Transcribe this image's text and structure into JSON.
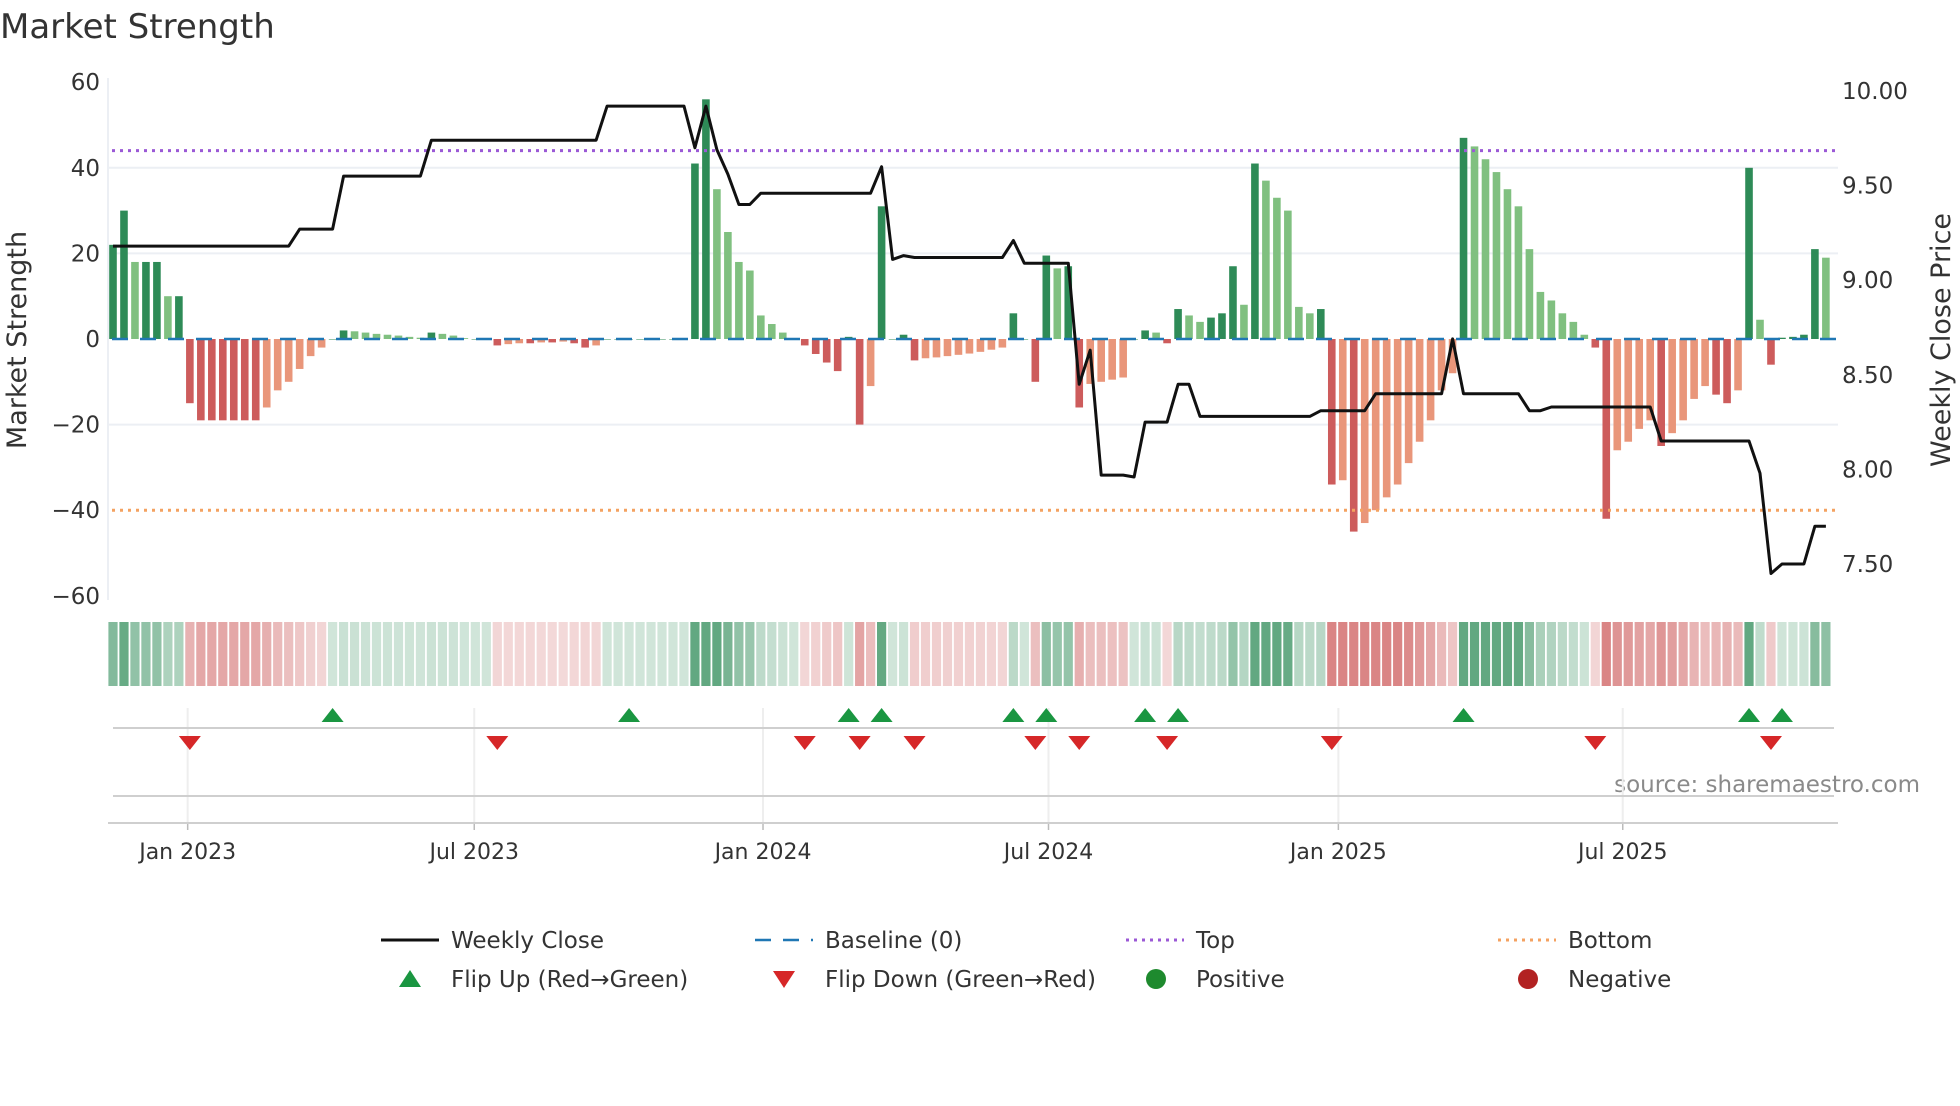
{
  "chart_data": {
    "type": "bar",
    "title": "Market Strength",
    "ylabel": "Market Strength",
    "y2label": "Weekly Close Price",
    "ylim": [
      -60,
      60
    ],
    "y2lim": [
      7.35,
      10.05
    ],
    "yticks": [
      "60",
      "40",
      "20",
      "0",
      "−20",
      "−40",
      "−60"
    ],
    "ytick_values": [
      60,
      40,
      20,
      0,
      -20,
      -40,
      -60
    ],
    "y2ticks": [
      "10.00",
      "9.50",
      "9.00",
      "8.50",
      "8.00",
      "7.50"
    ],
    "y2tick_values": [
      10,
      9.5,
      9,
      8.5,
      8,
      7.5
    ],
    "xticks": [
      {
        "label": "Jan 2023",
        "week": 6.8
      },
      {
        "label": "Jul 2023",
        "week": 32.9
      },
      {
        "label": "Jan 2024",
        "week": 59.2
      },
      {
        "label": "Jul 2024",
        "week": 85.2
      },
      {
        "label": "Jan 2025",
        "week": 111.6
      },
      {
        "label": "Jul 2025",
        "week": 137.5
      }
    ],
    "top_level": 44,
    "bottom_level": -40,
    "baseline": 0,
    "strength": [
      22,
      30,
      18,
      18,
      18,
      10,
      10,
      -15,
      -19,
      -19,
      -19,
      -19,
      -19,
      -19,
      -16,
      -12,
      -10,
      -7,
      -4,
      -2,
      0,
      2,
      1.8,
      1.5,
      1.2,
      1,
      0.8,
      0.5,
      0.3,
      1.5,
      1.2,
      0.8,
      0.2,
      0,
      0,
      -1.5,
      -1.2,
      -1,
      -1,
      -0.8,
      -0.8,
      -0.6,
      -1,
      -2,
      -1.5,
      0,
      0,
      0,
      0,
      0,
      0,
      0,
      0,
      41,
      56,
      35,
      25,
      18,
      16,
      5.5,
      3.5,
      1.5,
      0,
      -1.5,
      -3.5,
      -5.5,
      -7.5,
      0.5,
      -20,
      -11,
      31,
      0,
      1,
      -5,
      -4.5,
      -4.3,
      -4,
      -3.7,
      -3.4,
      -3,
      -2.5,
      -2,
      6,
      0,
      -10,
      19.5,
      16.5,
      17,
      -16,
      -10.5,
      -10,
      -9.5,
      -9,
      0,
      2,
      1.5,
      -1,
      7,
      5.5,
      4,
      5,
      6,
      17,
      8,
      41,
      37,
      33,
      30,
      7.5,
      6,
      7,
      -34,
      -33,
      -45,
      -43,
      -40,
      -37,
      -34,
      -29,
      -24,
      -19,
      -12,
      -8,
      47,
      45,
      42,
      39,
      35,
      31,
      21,
      11,
      9,
      6,
      4,
      1,
      -2,
      -42,
      -26,
      -24,
      -21,
      -19,
      -25,
      -22,
      -19,
      -14,
      -11,
      -13,
      -15,
      -12,
      40,
      4.5,
      -6,
      0.3,
      0.5,
      1,
      21,
      19
    ],
    "weekly_close": [
      9.18,
      9.18,
      9.18,
      9.18,
      9.18,
      9.18,
      9.18,
      9.18,
      9.18,
      9.18,
      9.18,
      9.18,
      9.18,
      9.18,
      9.18,
      9.18,
      9.18,
      9.27,
      9.27,
      9.27,
      9.27,
      9.55,
      9.55,
      9.55,
      9.55,
      9.55,
      9.55,
      9.55,
      9.55,
      9.74,
      9.74,
      9.74,
      9.74,
      9.74,
      9.74,
      9.74,
      9.74,
      9.74,
      9.74,
      9.74,
      9.74,
      9.74,
      9.74,
      9.74,
      9.74,
      9.92,
      9.92,
      9.92,
      9.92,
      9.92,
      9.92,
      9.92,
      9.92,
      9.7,
      9.92,
      9.69,
      9.56,
      9.4,
      9.4,
      9.46,
      9.46,
      9.46,
      9.46,
      9.46,
      9.46,
      9.46,
      9.46,
      9.46,
      9.46,
      9.46,
      9.6,
      9.11,
      9.13,
      9.12,
      9.12,
      9.12,
      9.12,
      9.12,
      9.12,
      9.12,
      9.12,
      9.12,
      9.21,
      9.09,
      9.09,
      9.09,
      9.09,
      9.09,
      8.45,
      8.63,
      7.97,
      7.97,
      7.97,
      7.96,
      8.25,
      8.25,
      8.25,
      8.45,
      8.45,
      8.28,
      8.28,
      8.28,
      8.28,
      8.28,
      8.28,
      8.28,
      8.28,
      8.28,
      8.28,
      8.28,
      8.31,
      8.31,
      8.31,
      8.31,
      8.31,
      8.4,
      8.4,
      8.4,
      8.4,
      8.4,
      8.4,
      8.4,
      8.69,
      8.4,
      8.4,
      8.4,
      8.4,
      8.4,
      8.4,
      8.31,
      8.31,
      8.33,
      8.33,
      8.33,
      8.33,
      8.33,
      8.33,
      8.33,
      8.33,
      8.33,
      8.33,
      8.15,
      8.15,
      8.15,
      8.15,
      8.15,
      8.15,
      8.15,
      8.15,
      8.15,
      7.98,
      7.45,
      7.5,
      7.5,
      7.5,
      7.7,
      7.7
    ],
    "flip_up_weeks": [
      20,
      47,
      67,
      70,
      82,
      85,
      94,
      97,
      123,
      149,
      152
    ],
    "flip_down_weeks": [
      7,
      35,
      63,
      68,
      73,
      84,
      88,
      96,
      111,
      135,
      151
    ],
    "legend": [
      {
        "label": "Weekly Close",
        "kind": "line"
      },
      {
        "label": "Baseline (0)",
        "kind": "dash"
      },
      {
        "label": "Top",
        "kind": "dot-purple"
      },
      {
        "label": "Bottom",
        "kind": "dot-orange"
      },
      {
        "label": "Flip Up (Red→Green)",
        "kind": "tri-up"
      },
      {
        "label": "Flip Down (Green→Red)",
        "kind": "tri-down"
      },
      {
        "label": "Positive",
        "kind": "circle-green"
      },
      {
        "label": "Negative",
        "kind": "circle-red"
      }
    ],
    "legend_placement": "bottom",
    "source": "source: sharemaestro.com"
  },
  "colors": {
    "pos_strong": "#2e8b57",
    "pos_weak": "#80c080",
    "neg_strong": "#cd5c5c",
    "neg_weak": "#e9967a",
    "baseline": "#1f77b4",
    "top": "#9b59d6",
    "bottom": "#f4a261",
    "close": "#111111",
    "flip_up": "#1a9641",
    "flip_down": "#d62728",
    "positive_dot": "#1e8a2e",
    "negative_dot": "#b22222"
  }
}
